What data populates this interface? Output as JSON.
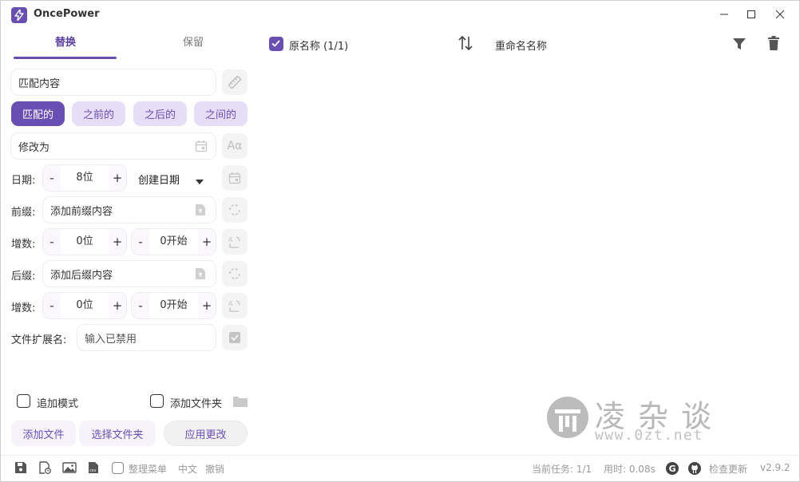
{
  "app": {
    "title": "OncePower"
  },
  "tabs": [
    {
      "label": "替换"
    },
    {
      "label": "保留"
    }
  ],
  "match": {
    "placeholder": "匹配内容"
  },
  "modes": [
    {
      "label": "匹配的",
      "active": true
    },
    {
      "label": "之前的",
      "active": false
    },
    {
      "label": "之后的",
      "active": false
    },
    {
      "label": "之间的",
      "active": false
    }
  ],
  "modify": {
    "placeholder": "修改为"
  },
  "date_row": {
    "label": "日期:",
    "digits": "8位",
    "type": "创建日期"
  },
  "prefix": {
    "label": "前缀:",
    "placeholder": "添加前缀内容"
  },
  "increment1": {
    "label": "增数:",
    "digits": "0位",
    "start": "0开始"
  },
  "suffix": {
    "label": "后缀:",
    "placeholder": "添加后缀内容"
  },
  "increment2": {
    "label": "增数:",
    "digits": "0位",
    "start": "0开始"
  },
  "extension": {
    "label": "文件扩展名:",
    "placeholder": "输入已禁用"
  },
  "options": {
    "append_mode": "追加模式",
    "add_folder": "添加文件夹"
  },
  "buttons": {
    "add_files": "添加文件",
    "select_folder": "选择文件夹",
    "apply": "应用更改"
  },
  "statusbar": {
    "organize_menu": "整理菜单",
    "language": "中文",
    "undo": "撤销",
    "current_task": "当前任务: 1/1",
    "elapsed": "用时: 0.08s",
    "check_update": "检查更新",
    "version": "v2.9.2"
  },
  "list_header": {
    "original_name": "原名称 (1/1)",
    "renamed_name": "重命名名称"
  },
  "watermark": {
    "chars": "凌 杂 谈",
    "url": "www.0zt.net"
  },
  "colors": {
    "accent": "#6a4fb3",
    "accent_light": "#e6def7"
  }
}
